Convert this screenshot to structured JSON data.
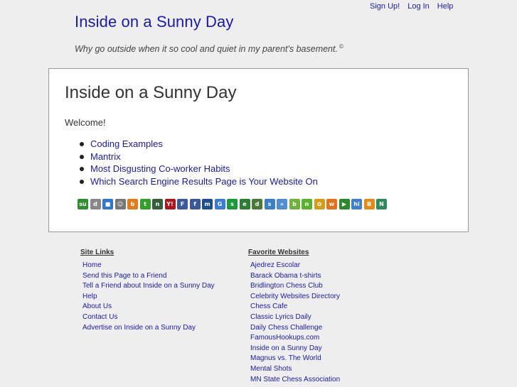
{
  "top_links": [
    "Sign Up!",
    "Log In",
    "Help"
  ],
  "site": {
    "title": "Inside on a Sunny Day",
    "tagline": "Why go outside when it so cool and quiet in my parent's basement.",
    "tagline_mark": "©"
  },
  "main": {
    "title": "Inside on a Sunny Day",
    "welcome": "Welcome!",
    "posts": [
      "Coding Examples",
      "Mantrix",
      "Most Disgusting Co-worker Habits",
      "Which Search Engine Results Page is Your Website On"
    ]
  },
  "share_icons": [
    {
      "name": "stumbleupon-icon",
      "glyph": "su",
      "color": "#2f8f2f"
    },
    {
      "name": "digg-icon",
      "glyph": "d",
      "color": "#888888"
    },
    {
      "name": "delicious-icon",
      "glyph": "■",
      "color": "#3274d1"
    },
    {
      "name": "reddit-icon",
      "glyph": "☺",
      "color": "#777777"
    },
    {
      "name": "blinklist-icon",
      "glyph": "b",
      "color": "#e47b1b"
    },
    {
      "name": "technorati-icon",
      "glyph": "t",
      "color": "#33a02c"
    },
    {
      "name": "newsvine-icon",
      "glyph": "n",
      "color": "#355e3b"
    },
    {
      "name": "yahoo-icon",
      "glyph": "Y!",
      "color": "#b0141c"
    },
    {
      "name": "furl-icon",
      "glyph": "F",
      "color": "#3a5a9a"
    },
    {
      "name": "facebook-icon",
      "glyph": "f",
      "color": "#3b5998"
    },
    {
      "name": "myspace-icon",
      "glyph": "m",
      "color": "#1f4e8c"
    },
    {
      "name": "google-icon",
      "glyph": "G",
      "color": "#3b7bd6"
    },
    {
      "name": "spurl-icon",
      "glyph": "s",
      "color": "#1b9a3c"
    },
    {
      "name": "evernote-icon",
      "glyph": "e",
      "color": "#2e7d32"
    },
    {
      "name": "diigo-icon",
      "glyph": "d",
      "color": "#4a7a3a"
    },
    {
      "name": "simpy-icon",
      "glyph": "s",
      "color": "#3a7fc8"
    },
    {
      "name": "blinkbits-icon",
      "glyph": "»",
      "color": "#4f8fcf"
    },
    {
      "name": "backflip-icon",
      "glyph": "b",
      "color": "#6fb23a"
    },
    {
      "name": "netvouz-icon",
      "glyph": "n",
      "color": "#5bb030"
    },
    {
      "name": "segnalo-icon",
      "glyph": "✿",
      "color": "#d69b18"
    },
    {
      "name": "mister-wong-icon",
      "glyph": "w",
      "color": "#e3711c"
    },
    {
      "name": "propeller-icon",
      "glyph": "▶",
      "color": "#2a8a2a"
    },
    {
      "name": "hi5-icon",
      "glyph": "hi",
      "color": "#3f7fd0"
    },
    {
      "name": "blogmarks-icon",
      "glyph": "B",
      "color": "#e48a18"
    },
    {
      "name": "netscape-icon",
      "glyph": "N",
      "color": "#2d8c5a"
    }
  ],
  "site_links": {
    "heading": "Site Links",
    "items": [
      "Home",
      "Send this Page to a Friend",
      "Tell a Friend about Inside on a Sunny Day",
      "Help",
      "About Us",
      "Contact Us",
      "Advertise on Inside on a Sunny Day"
    ]
  },
  "favorite_websites": {
    "heading": "Favorite Websites",
    "items": [
      "Ajedrez Escolar",
      "Barack Obama t-shirts",
      "Bridlington Chess Club",
      "Celebrity Websites Directory",
      "Chess Cafe",
      "Classic Lyrics Daily",
      "Daily Chess Challenge",
      "FamousHookups.com",
      "Inside on a Sunny Day",
      "Magnus vs. The World",
      "Mental Shots",
      "MN State Chess Association"
    ]
  }
}
